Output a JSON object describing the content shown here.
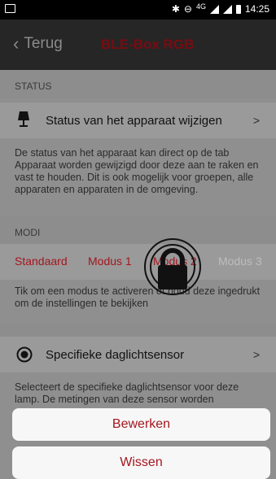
{
  "status_bar": {
    "network": "4G",
    "time": "14:25"
  },
  "app_bar": {
    "back_label": "Terug",
    "title": "BLE-Box RGB"
  },
  "status_section": {
    "header": "STATUS",
    "row_label": "Status van het apparaat wijzigen",
    "description": "De status van het apparaat kan direct op de tab Apparaat worden gewijzigd door deze aan te raken en vast te houden. Dit is ook mogelijk voor groepen, alle apparaten en apparaten in de omgeving."
  },
  "modi_section": {
    "header": "MODI",
    "modes": [
      "Standaard",
      "Modus 1",
      "Modus 2",
      "Modus 3"
    ],
    "description": "Tik om een modus te activeren of houd deze ingedrukt om de instellingen te bekijken"
  },
  "sensor_section": {
    "row_label": "Specifieke daglichtsensor",
    "description": "Selecteert de specifieke daglichtsensor voor deze lamp. De metingen van deze sensor worden"
  },
  "action_sheet": {
    "edit_label": "Bewerken",
    "delete_label": "Wissen"
  },
  "colors": {
    "accent": "#a4161f",
    "title": "#7a0b12"
  }
}
